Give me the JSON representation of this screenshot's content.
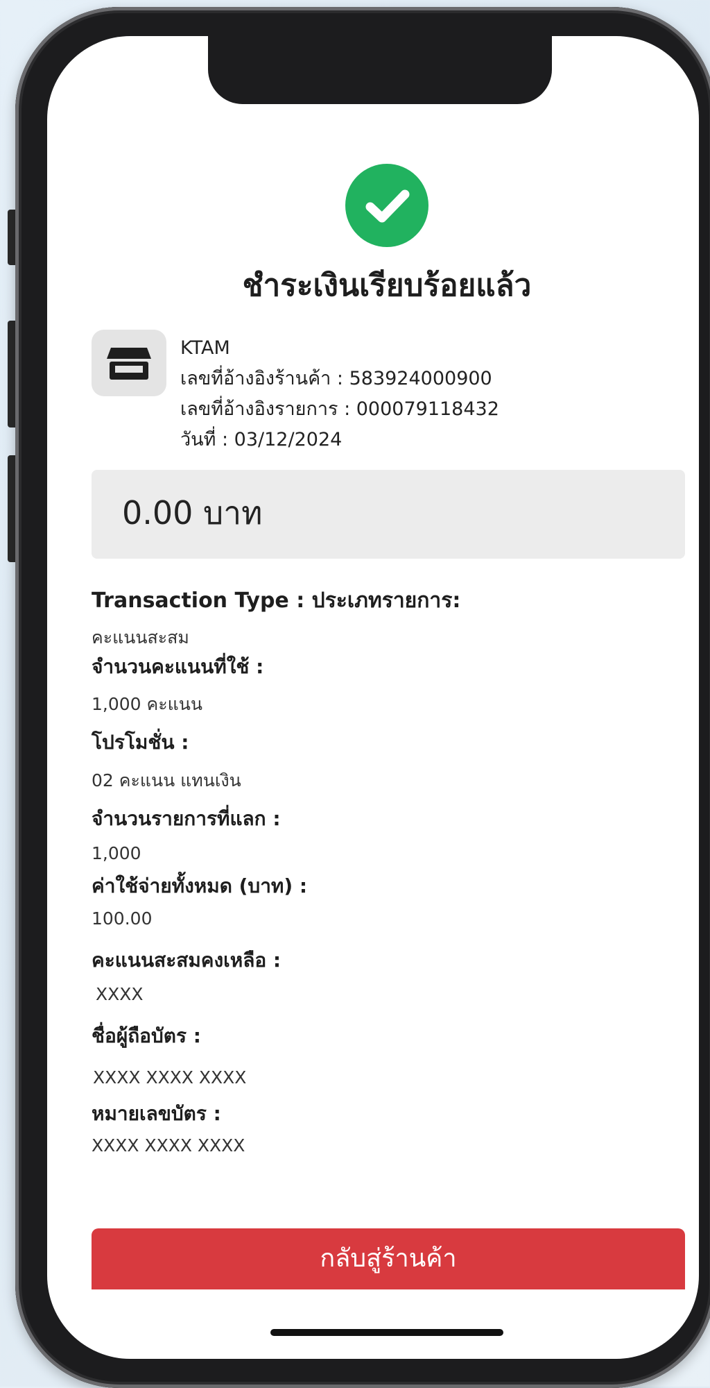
{
  "receipt": {
    "title": "ชำระเงินเรียบร้อยแล้ว",
    "merchant_name": "KTAM",
    "merchant_ref": "เลขที่อ้างอิงร้านค้า : 583924000900",
    "transaction_ref": "เลขที่อ้างอิงรายการ : 000079118432",
    "date": "วันที่ : 03/12/2024",
    "amount": "0.00 บาท"
  },
  "details": [
    {
      "label": "Transaction Type : ประเภทรายการ:",
      "value": "คะแนนสะสม"
    },
    {
      "label": "จำนวนคะแนนที่ใช้ :",
      "value": "1,000 คะแนน"
    },
    {
      "label": "โปรโมชั่น :",
      "value": "02 คะแนน แทนเงิน"
    },
    {
      "label": "จำนวนรายการที่แลก :",
      "value": "1,000"
    },
    {
      "label": "ค่าใช้จ่ายทั้งหมด (บาท) :",
      "value": "100.00"
    },
    {
      "label": "คะแนนสะสมคงเหลือ :",
      "value": "XXXX"
    },
    {
      "label": "ชื่อผู้ถือบัตร :",
      "value": "XXXX XXXX XXXX"
    },
    {
      "label": "หมายเลขบัตร :",
      "value": "XXXX XXXX XXXX"
    }
  ],
  "actions": {
    "back_to_store": "กลับสู่ร้านค้า"
  },
  "colors": {
    "success": "#21b25f",
    "button": "#d83a3f",
    "amount_bg": "#ececec",
    "store_icon_bg": "#e4e4e4"
  },
  "icons": {
    "status": "check-circle-icon",
    "merchant": "store-icon"
  }
}
